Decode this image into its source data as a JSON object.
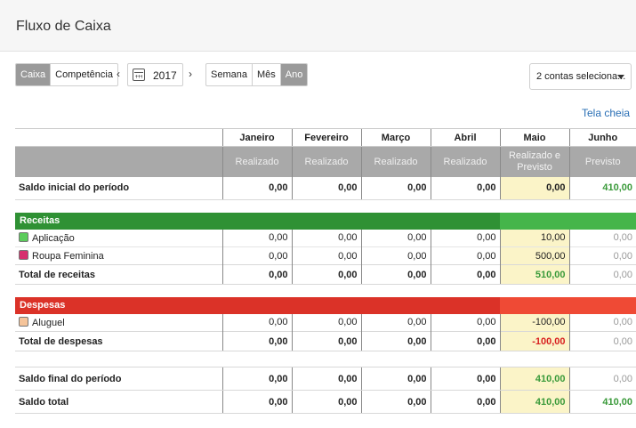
{
  "page": {
    "title": "Fluxo de Caixa"
  },
  "toolbar": {
    "mode": {
      "options": [
        "Caixa",
        "Competência"
      ],
      "active": "Caixa"
    },
    "prev_arrow": "‹",
    "next_arrow": "›",
    "year": "2017",
    "period": {
      "options": [
        "Semana",
        "Mês",
        "Ano"
      ],
      "active": "Ano"
    },
    "accounts_select": "2 contas seleciona...",
    "fullscreen_link": "Tela cheia"
  },
  "table": {
    "months": [
      "Janeiro",
      "Fevereiro",
      "Março",
      "Abril",
      "Maio",
      "Junho"
    ],
    "subheaders": [
      "Realizado",
      "Realizado",
      "Realizado",
      "Realizado",
      "Realizado e Previsto",
      "Previsto"
    ],
    "rows": {
      "saldo_inicial": {
        "label": "Saldo inicial do período",
        "values": [
          "0,00",
          "0,00",
          "0,00",
          "0,00",
          "0,00",
          "410,00"
        ]
      },
      "receitas": {
        "label": "Receitas"
      },
      "aplicacao": {
        "label": "Aplicação",
        "color": "#5ccc5c",
        "values": [
          "0,00",
          "0,00",
          "0,00",
          "0,00",
          "10,00",
          "0,00"
        ]
      },
      "roupa": {
        "label": "Roupa Feminina",
        "color": "#d6306e",
        "values": [
          "0,00",
          "0,00",
          "0,00",
          "0,00",
          "500,00",
          "0,00"
        ]
      },
      "total_receitas": {
        "label": "Total de receitas",
        "values": [
          "0,00",
          "0,00",
          "0,00",
          "0,00",
          "510,00",
          "0,00"
        ]
      },
      "despesas": {
        "label": "Despesas"
      },
      "aluguel": {
        "label": "Aluguel",
        "color": "#f5c49a",
        "values": [
          "0,00",
          "0,00",
          "0,00",
          "0,00",
          "-100,00",
          "0,00"
        ]
      },
      "total_despesas": {
        "label": "Total de despesas",
        "values": [
          "0,00",
          "0,00",
          "0,00",
          "0,00",
          "-100,00",
          "0,00"
        ]
      },
      "saldo_final": {
        "label": "Saldo final do período",
        "values": [
          "0,00",
          "0,00",
          "0,00",
          "0,00",
          "410,00",
          "0,00"
        ]
      },
      "saldo_total": {
        "label": "Saldo total",
        "values": [
          "0,00",
          "0,00",
          "0,00",
          "0,00",
          "410,00",
          "410,00"
        ]
      }
    }
  },
  "colors": {
    "receitas": "#2f9134",
    "despesas": "#db3228",
    "accent_link": "#2a6fb5",
    "positive": "#3a9a3a",
    "negative": "#d82020"
  }
}
